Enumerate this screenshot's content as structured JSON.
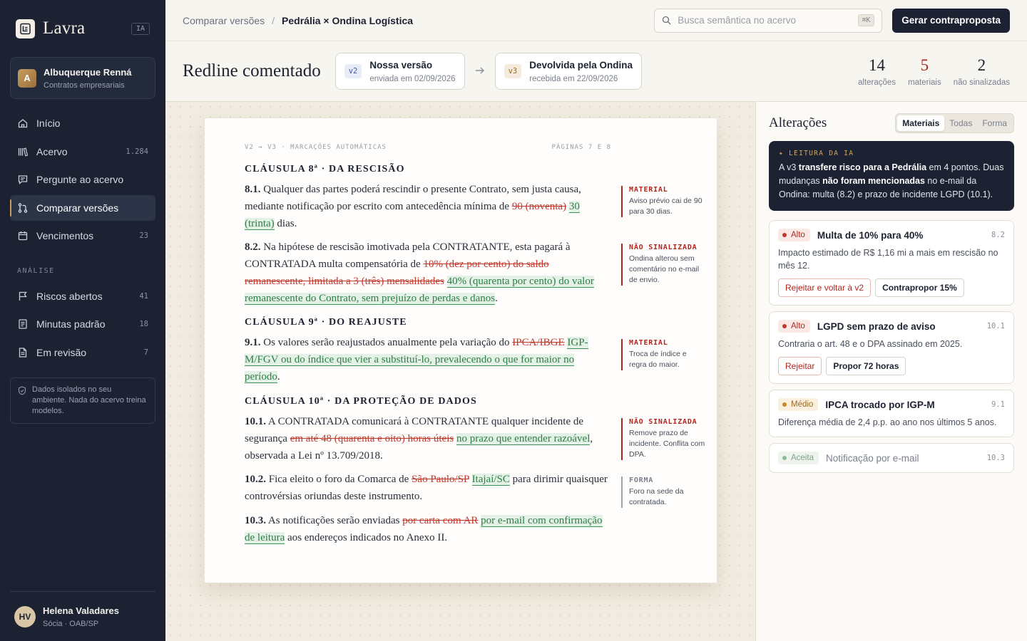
{
  "brand": {
    "name": "Lavra",
    "badge": "IA"
  },
  "workspace": {
    "initial": "A",
    "name": "Albuquerque Renná",
    "subtitle": "Contratos empresariais"
  },
  "nav": [
    {
      "label": "Início",
      "icon": "home-icon",
      "count": ""
    },
    {
      "label": "Acervo",
      "icon": "library-icon",
      "count": "1.284"
    },
    {
      "label": "Pergunte ao acervo",
      "icon": "chat-icon",
      "count": ""
    },
    {
      "label": "Comparar versões",
      "icon": "compare-icon",
      "count": "",
      "active": true
    },
    {
      "label": "Vencimentos",
      "icon": "calendar-icon",
      "count": "23"
    }
  ],
  "analysis_section": "ANÁLISE",
  "analysis_nav": [
    {
      "label": "Riscos abertos",
      "icon": "flag-icon",
      "count": "41"
    },
    {
      "label": "Minutas padrão",
      "icon": "template-icon",
      "count": "18"
    },
    {
      "label": "Em revisão",
      "icon": "document-icon",
      "count": "7"
    }
  ],
  "privacy_note": "Dados isolados no seu ambiente. Nada do acervo treina modelos.",
  "user": {
    "initials": "HV",
    "name": "Helena Valadares",
    "role": "Sócia · OAB/SP"
  },
  "breadcrumb": {
    "parent": "Comparar versões",
    "current": "Pedrália × Ondina Logística"
  },
  "search": {
    "placeholder": "Busca semântica no acervo",
    "shortcut": "⌘K"
  },
  "primary_action": "Gerar contraproposta",
  "page_title": "Redline comentado",
  "versions": {
    "from": {
      "tag": "v2",
      "title": "Nossa versão",
      "subtitle": "enviada em 02/09/2026"
    },
    "to": {
      "tag": "v3",
      "title": "Devolvida pela Ondina",
      "subtitle": "recebida em 22/09/2026"
    }
  },
  "stats": [
    {
      "value": "14",
      "label": "alterações"
    },
    {
      "value": "5",
      "label": "materiais"
    },
    {
      "value": "2",
      "label": "não sinalizadas"
    }
  ],
  "document": {
    "meta_left": "V2 → V3 · MARCAÇÕES AUTOMÁTICAS",
    "meta_right": "PÁGINAS 7 E 8",
    "clause8_title": "CLÁUSULA 8ª · DA RESCISÃO",
    "p81": {
      "num": "8.1.",
      "pre": " Qualquer das partes poderá rescindir o presente Contrato, sem justa causa, mediante notificação por escrito com antecedência mínima de ",
      "del": "90 (noventa)",
      "ins": "30 (trinta)",
      "post": " dias."
    },
    "p82": {
      "num": "8.2.",
      "pre": " Na hipótese de rescisão imotivada pela CONTRATANTE, esta pagará à CONTRATADA multa compensatória de ",
      "del": "10% (dez por cento) do saldo remanescente, limitada a 3 (três) mensalidades",
      "ins": "40% (quarenta por cento) do valor remanescente do Contrato, sem prejuízo de perdas e danos",
      "post": "."
    },
    "clause9_title": "CLÁUSULA 9ª · DO REAJUSTE",
    "p91": {
      "num": "9.1.",
      "pre": " Os valores serão reajustados anualmente pela variação do ",
      "del": "IPCA/IBGE",
      "ins": "IGP-M/FGV ou do índice que vier a substituí-lo, prevalecendo o que for maior no período",
      "post": "."
    },
    "clause10_title": "CLÁUSULA 10ª · DA PROTEÇÃO DE DADOS",
    "p101": {
      "num": "10.1.",
      "pre": " A CONTRATADA comunicará à CONTRATANTE qualquer incidente de segurança ",
      "del": "em até 48 (quarenta e oito) horas úteis",
      "ins": "no prazo que entender razoável",
      "post": ", observada a Lei nº 13.709/2018."
    },
    "p102": {
      "num": "10.2.",
      "pre": " Fica eleito o foro da Comarca de ",
      "del": "São Paulo/SP",
      "ins": "Itajaí/SC",
      "post": " para dirimir quaisquer controvérsias oriundas deste instrumento."
    },
    "p103": {
      "num": "10.3.",
      "pre": " As notificações serão enviadas ",
      "del": "por carta com AR",
      "ins": "por e-mail com confirmação de leitura",
      "post": " aos endereços indicados no Anexo II."
    },
    "notes": [
      {
        "tag": "MATERIAL",
        "text": "Aviso prévio cai de 90 para 30 dias."
      },
      {
        "tag": "NÃO SINALIZADA",
        "text": "Ondina alterou sem comentário no e-mail de envio."
      },
      {
        "tag": "MATERIAL",
        "text": "Troca de índice e regra do maior."
      },
      {
        "tag": "NÃO SINALIZADA",
        "text": "Remove prazo de incidente. Conflita com DPA."
      },
      {
        "tag": "FORMA",
        "text": "Foro na sede da contratada."
      }
    ]
  },
  "panel": {
    "title": "Alterações",
    "filters": [
      "Materiais",
      "Todas",
      "Forma"
    ],
    "ai": {
      "tag": "✦ LEITURA DA IA",
      "t1": "A v3 ",
      "b1": "transfere risco para a Pedrália",
      "t2": " em 4 pontos. Duas mudanças ",
      "b2": "não foram mencionadas",
      "t3": " no e-mail da Ondina: multa (8.2) e prazo de incidente LGPD (10.1)."
    },
    "changes": [
      {
        "severity": "Alto",
        "title": "Multa de 10% para 40%",
        "ref": "8.2",
        "desc": "Impacto estimado de R$ 1,16 mi a mais em rescisão no mês 12.",
        "actions": [
          "Rejeitar e voltar à v2",
          "Contrapropor 15%"
        ]
      },
      {
        "severity": "Alto",
        "title": "LGPD sem prazo de aviso",
        "ref": "10.1",
        "desc": "Contraria o art. 48 e o DPA assinado em 2025.",
        "actions": [
          "Rejeitar",
          "Propor 72 horas"
        ]
      },
      {
        "severity": "Médio",
        "title": "IPCA trocado por IGP-M",
        "ref": "9.1",
        "desc": "Diferença média de 2,4 p.p. ao ano nos últimos 5 anos."
      },
      {
        "severity": "Aceita",
        "title": "Notificação por e-mail",
        "ref": "10.3"
      }
    ]
  }
}
